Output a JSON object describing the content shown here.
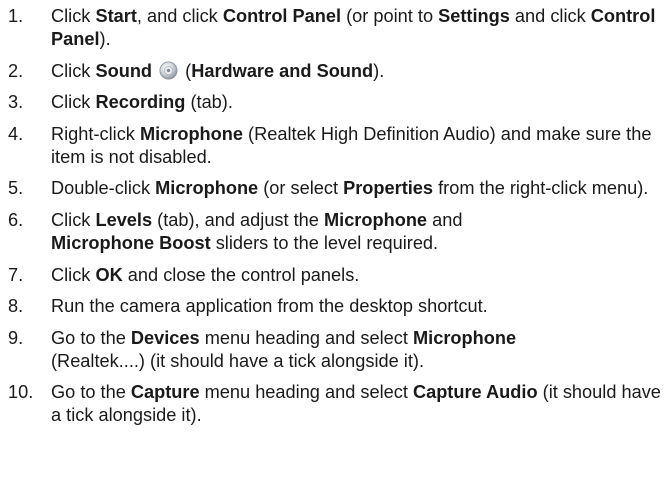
{
  "steps": [
    {
      "num": "1.",
      "parts": [
        {
          "t": "Click "
        },
        {
          "t": "Start",
          "b": true
        },
        {
          "t": ", and click "
        },
        {
          "t": "Control Panel",
          "b": true
        },
        {
          "t": " (or point to "
        },
        {
          "t": "Settings",
          "b": true
        },
        {
          "t": " and click "
        },
        {
          "t": "Control Panel",
          "b": true
        },
        {
          "t": ")."
        }
      ]
    },
    {
      "num": "2.",
      "parts": [
        {
          "t": "Click "
        },
        {
          "t": "Sound",
          "b": true
        },
        {
          "icon": "sound-icon"
        },
        {
          "t": " ("
        },
        {
          "t": "Hardware and Sound",
          "b": true
        },
        {
          "t": ")."
        }
      ]
    },
    {
      "num": "3.",
      "parts": [
        {
          "t": "Click "
        },
        {
          "t": "Recording",
          "b": true
        },
        {
          "t": " (tab)."
        }
      ]
    },
    {
      "num": "4.",
      "parts": [
        {
          "t": "Right-click "
        },
        {
          "t": "Microphone",
          "b": true
        },
        {
          "t": " (Realtek High Definition Audio) and make sure the item is not disabled."
        }
      ]
    },
    {
      "num": "5.",
      "parts": [
        {
          "t": "Double-click "
        },
        {
          "t": "Microphone",
          "b": true
        },
        {
          "t": " (or select "
        },
        {
          "t": "Properties",
          "b": true
        },
        {
          "t": " from the right-click menu)."
        }
      ]
    },
    {
      "num": "6.",
      "parts": [
        {
          "t": "Click "
        },
        {
          "t": "Levels",
          "b": true
        },
        {
          "t": " (tab), and adjust the "
        },
        {
          "t": "Microphone",
          "b": true
        },
        {
          "t": " and "
        },
        {
          "br": true
        },
        {
          "t": "Microphone Boost",
          "b": true
        },
        {
          "t": " sliders to the level required."
        }
      ]
    },
    {
      "num": "7.",
      "parts": [
        {
          "t": "Click "
        },
        {
          "t": "OK",
          "b": true
        },
        {
          "t": " and close the control panels."
        }
      ]
    },
    {
      "num": "8.",
      "parts": [
        {
          "t": "Run the camera application from the desktop shortcut."
        }
      ]
    },
    {
      "num": "9.",
      "parts": [
        {
          "t": "Go to the "
        },
        {
          "t": "Devices",
          "b": true
        },
        {
          "t": " menu heading and select "
        },
        {
          "t": "Microphone",
          "b": true
        },
        {
          "br": true
        },
        {
          "t": "(Realtek....) (it should have a tick alongside it)."
        }
      ]
    },
    {
      "num": "10.",
      "parts": [
        {
          "t": "Go to the "
        },
        {
          "t": "Capture",
          "b": true
        },
        {
          "t": " menu heading and select "
        },
        {
          "t": "Capture Audio",
          "b": true
        },
        {
          "t": " (it should have a tick alongside it)."
        }
      ]
    }
  ]
}
